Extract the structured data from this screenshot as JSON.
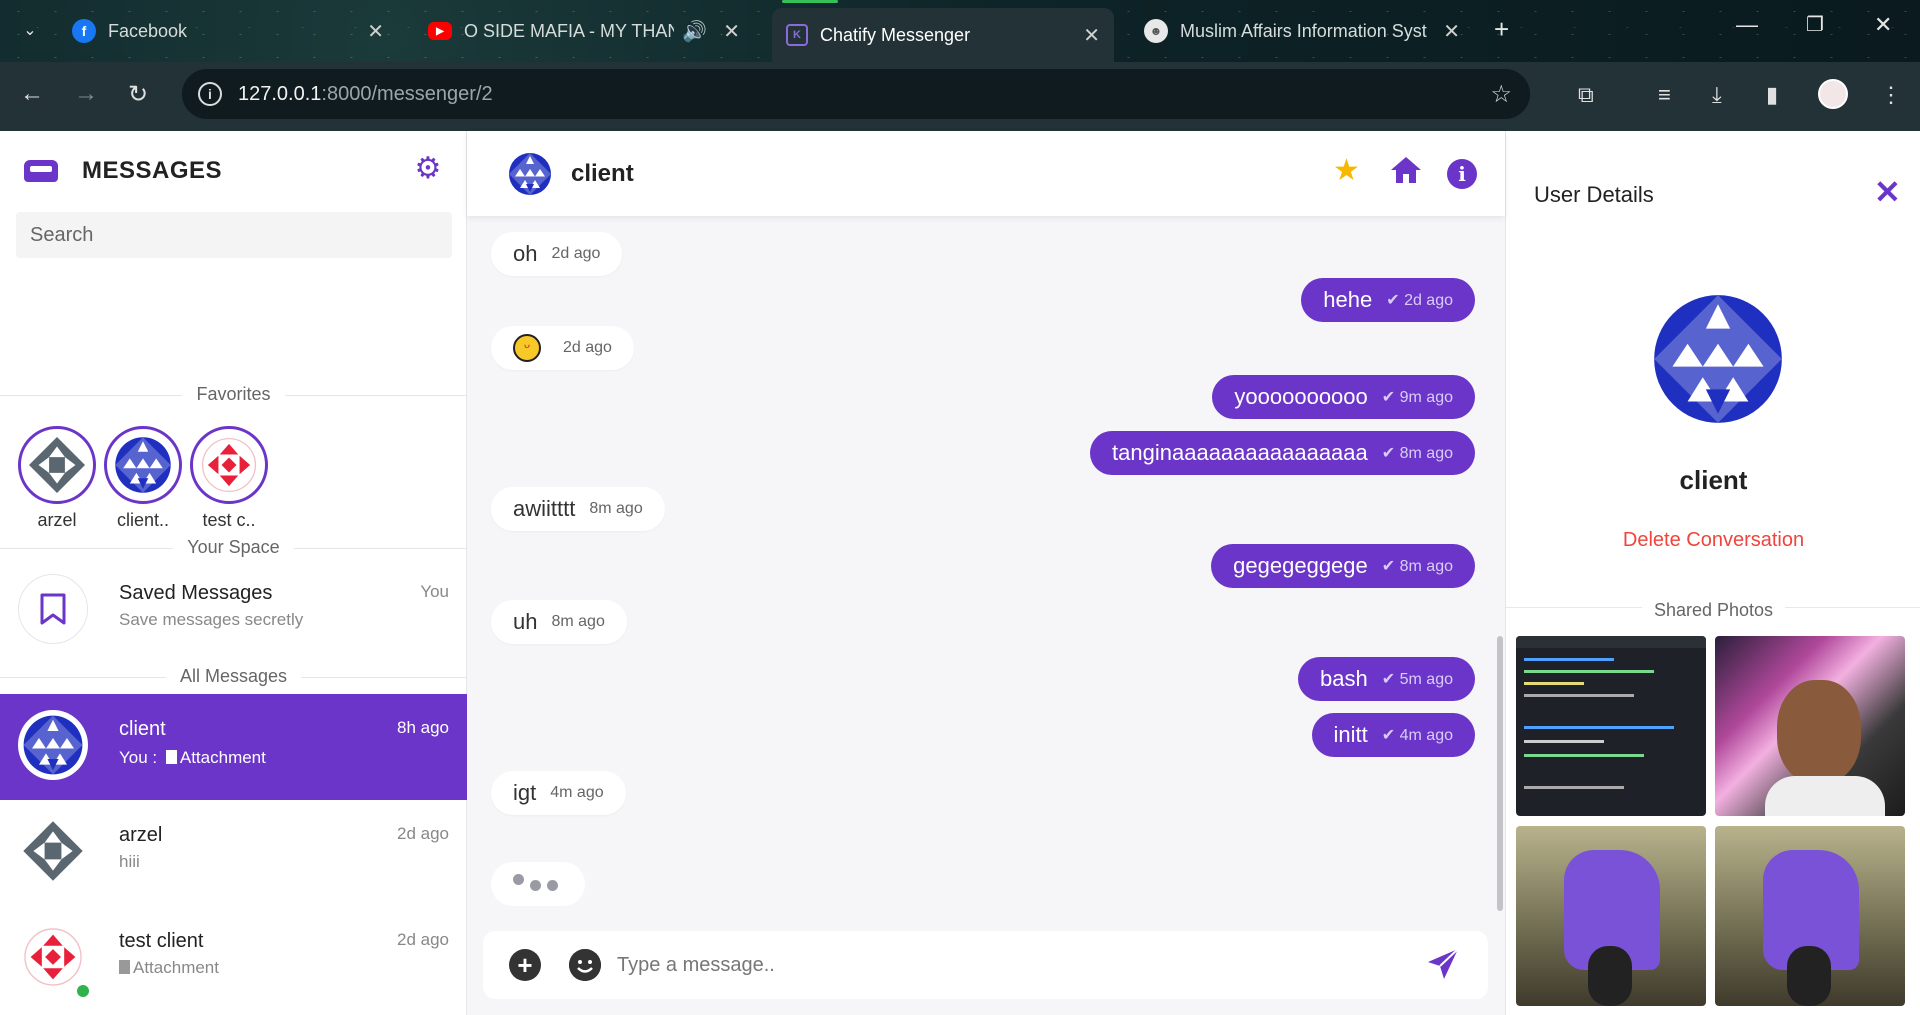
{
  "browser": {
    "tabs": [
      {
        "title": "Facebook",
        "icon": "facebook-icon",
        "active": false
      },
      {
        "title": "O SIDE MAFIA - MY THANG",
        "icon": "youtube-icon",
        "active": false
      },
      {
        "title": "Chatify Messenger",
        "icon": "chatify-icon",
        "active": true
      },
      {
        "title": "Muslim Affairs Information Syst",
        "icon": "site-icon",
        "active": false
      }
    ],
    "url_host": "127.0.0.1",
    "url_path": ":8000/messenger/2"
  },
  "sidebar": {
    "title": "MESSAGES",
    "search_placeholder": "Search",
    "favorites_title": "Favorites",
    "favorites": [
      {
        "name": "arzel",
        "avatar": "gray"
      },
      {
        "name": "client..",
        "avatar": "blue"
      },
      {
        "name": "test c..",
        "avatar": "red"
      }
    ],
    "your_space_title": "Your Space",
    "saved": {
      "name": "Saved Messages",
      "sub": "Save messages secretly",
      "time": "You"
    },
    "all_messages_title": "All Messages",
    "contacts": [
      {
        "name": "client",
        "prefix": "You :",
        "sub": "Attachment",
        "time": "8h ago",
        "avatar": "blue",
        "active": true
      },
      {
        "name": "arzel",
        "sub": "hiii",
        "time": "2d ago",
        "avatar": "gray",
        "active": false
      },
      {
        "name": "test client",
        "sub": "Attachment",
        "time": "2d ago",
        "avatar": "red",
        "active": false,
        "online": true
      }
    ]
  },
  "chat": {
    "contact_name": "client",
    "messages": [
      {
        "dir": "in",
        "text": "oh",
        "time": "2d ago"
      },
      {
        "dir": "out",
        "text": "hehe",
        "time": "2d ago"
      },
      {
        "dir": "in",
        "text": "",
        "emoji": "tongue-emoji",
        "time": "2d ago"
      },
      {
        "dir": "out",
        "text": "yoooooooooo",
        "time": "9m ago"
      },
      {
        "dir": "out",
        "text": "tanginaaaaaaaaaaaaaaaa",
        "time": "8m ago"
      },
      {
        "dir": "in",
        "text": "awiitttt",
        "time": "8m ago"
      },
      {
        "dir": "out",
        "text": "gegegeggege",
        "time": "8m ago"
      },
      {
        "dir": "in",
        "text": "uh",
        "time": "8m ago"
      },
      {
        "dir": "out",
        "text": "bash",
        "time": "5m ago"
      },
      {
        "dir": "out",
        "text": "initt",
        "time": "4m ago"
      },
      {
        "dir": "in",
        "text": "igt",
        "time": "4m ago"
      }
    ],
    "composer_placeholder": "Type a message.."
  },
  "details": {
    "title": "User Details",
    "name": "client",
    "delete_label": "Delete Conversation",
    "shared_title": "Shared Photos",
    "photos": [
      "code-screenshot",
      "selfie-photo",
      "scooter-photo",
      "scooter-photo"
    ]
  },
  "colors": {
    "accent": "#6a35c8",
    "danger": "#f0443c",
    "online": "#2fb34a"
  }
}
